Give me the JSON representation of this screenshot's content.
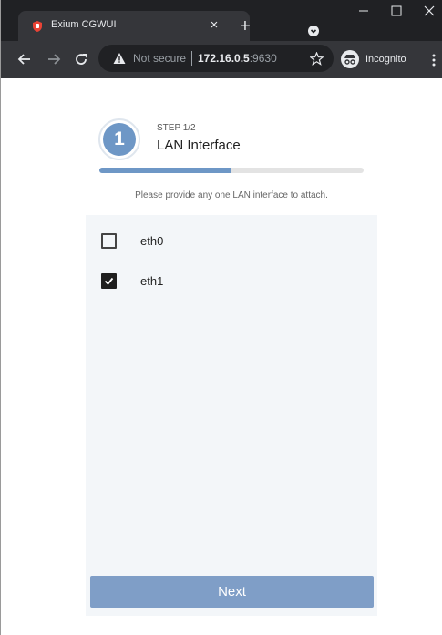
{
  "browser": {
    "tab": {
      "title": "Exium CGWUI",
      "close_glyph": "×",
      "favicon": "shield-favicon-icon"
    },
    "new_tab_glyph": "+",
    "omnibox": {
      "security_label": "Not secure",
      "host": "172.16.0.5",
      "port": ":9630"
    },
    "incognito_label": "Incognito",
    "colors": {
      "frame": "#202124",
      "toolbar": "#35363a",
      "favicon": "#ea4335"
    }
  },
  "wizard": {
    "step_number": "1",
    "step_count": "STEP 1/2",
    "step_title": "LAN Interface",
    "progress_fraction": 0.5,
    "hint": "Please provide any one LAN interface to attach.",
    "interfaces": [
      {
        "label": "eth0",
        "checked": false
      },
      {
        "label": "eth1",
        "checked": true
      }
    ],
    "next_label": "Next",
    "colors": {
      "accent": "#6e97c6",
      "button": "#7f9ec7",
      "panel": "#f3f6f9"
    }
  }
}
